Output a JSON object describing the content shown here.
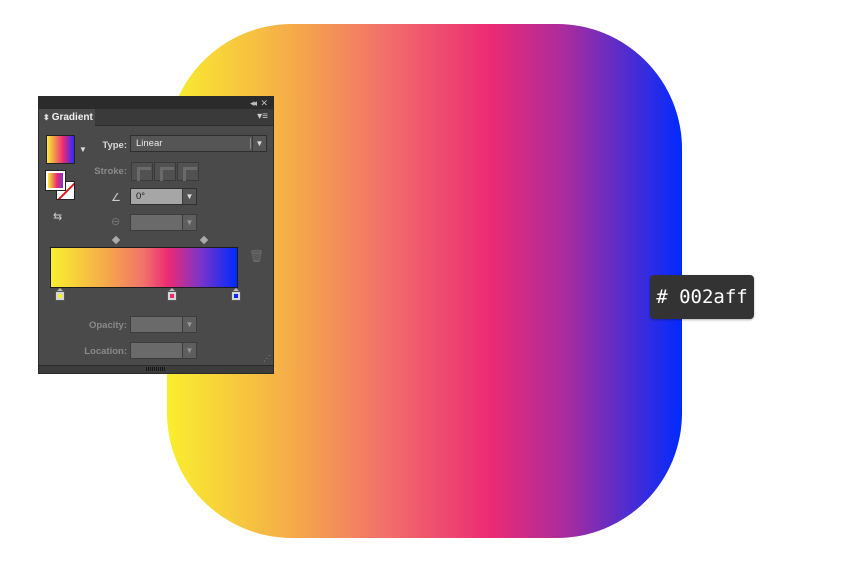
{
  "canvas": {
    "shape": {
      "gradient_type": "linear",
      "angle": "0°",
      "stops": [
        {
          "color": "#f9ef2e",
          "location": 0
        },
        {
          "color": "#ec2a74",
          "location": 63
        },
        {
          "color": "#002aff",
          "location": 100
        }
      ]
    },
    "tooltip": {
      "text": "# 002aff"
    }
  },
  "panel": {
    "title_buttons": {
      "collapse": "◂◂",
      "close": "✕"
    },
    "tab": {
      "arrows": "⬍",
      "label": "Gradient"
    },
    "menu_icon": "▾≡",
    "swatch_caret": "▼",
    "type": {
      "label": "Type:",
      "value": "Linear"
    },
    "stroke": {
      "label": "Stroke:"
    },
    "angle": {
      "value": "0°"
    },
    "aspect": {
      "value": ""
    },
    "opacity": {
      "label": "Opacity:",
      "value": ""
    },
    "location": {
      "label": "Location:",
      "value": ""
    },
    "stops": [
      {
        "color": "#f9ef2e",
        "position": 0
      },
      {
        "color": "#ec2a74",
        "position": 0.65
      },
      {
        "color": "#002aff",
        "position": 1
      }
    ],
    "midpoints": [
      0.35,
      0.82
    ],
    "icons": {
      "swap": "⇆",
      "angle": "∠",
      "aspect": "⊖",
      "trash": "🗑",
      "dropdown_arrow": "▼",
      "resize": "⋰"
    }
  }
}
